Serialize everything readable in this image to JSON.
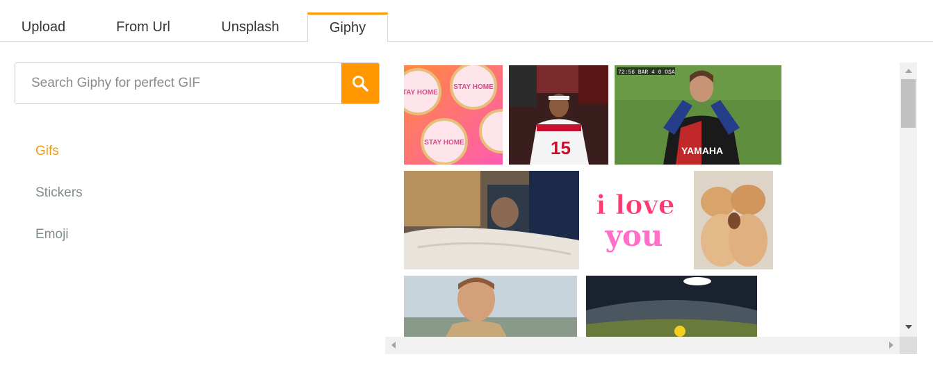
{
  "tabs": [
    {
      "label": "Upload",
      "active": false
    },
    {
      "label": "From Url",
      "active": false
    },
    {
      "label": "Unsplash",
      "active": false
    },
    {
      "label": "Giphy",
      "active": true
    }
  ],
  "search": {
    "placeholder": "Search Giphy for perfect GIF",
    "value": "",
    "button_icon": "search-icon"
  },
  "categories": [
    {
      "label": "Gifs",
      "active": true
    },
    {
      "label": "Stickers",
      "active": false
    },
    {
      "label": "Emoji",
      "active": false
    }
  ],
  "gifs": {
    "scoreboard": "72:56 BAR 4 0 OSA",
    "jersey_text": "YAMAHA",
    "jersey_number": "15",
    "sticker_line1": "i love",
    "sticker_line2": "you",
    "stay_home": "STAY HOME"
  },
  "colors": {
    "accent": "#ff9800",
    "active_category": "#f39c12",
    "inactive_category": "#7f8c8d"
  }
}
